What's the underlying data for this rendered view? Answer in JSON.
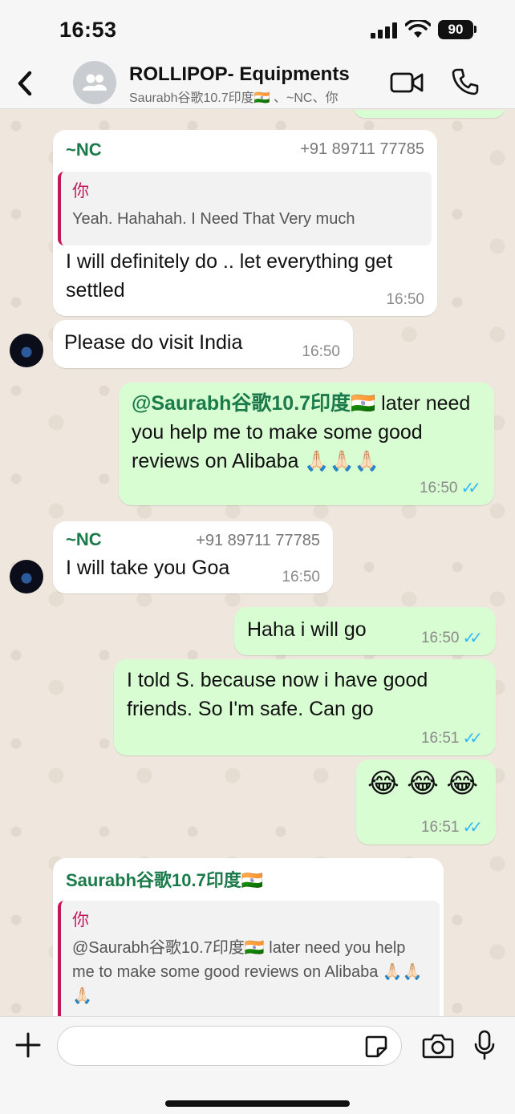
{
  "status": {
    "time": "16:53",
    "battery": "90"
  },
  "header": {
    "title": "ROLLIPOP- Equipments",
    "subtitle": "Saurabh谷歌10.7印度🇮🇳 、~NC、你"
  },
  "messages": {
    "m1": {
      "sender": "~NC",
      "phone": "+91 89711 77785",
      "quote_author": "你",
      "quote_text": "Yeah. Hahahah. I Need That Very much",
      "text": "I will definitely do .. let everything get settled",
      "time": "16:50"
    },
    "m2": {
      "text": "Please do visit India",
      "time": "16:50"
    },
    "m3": {
      "mention": "@Saurabh谷歌10.7印度🇮🇳",
      "text": " later need you help me to make some good reviews on Alibaba 🙏🏻🙏🏻🙏🏻",
      "time": "16:50"
    },
    "m4": {
      "sender": "~NC",
      "phone": "+91 89711 77785",
      "text": "I will take you Goa",
      "time": "16:50"
    },
    "m5": {
      "text": "Haha  i will go",
      "time": "16:50"
    },
    "m6": {
      "text": "I told S. because now i have good friends. So I'm safe. Can go",
      "time": "16:51"
    },
    "m7": {
      "text": "😂 😂 😂",
      "time": "16:51"
    },
    "m8": {
      "sender": "Saurabh谷歌10.7印度🇮🇳",
      "quote_author": "你",
      "quote_mention": "@Saurabh谷歌10.7印度🇮🇳",
      "quote_text": " later need you help me to make some good reviews on Alibaba 🙏🏻🙏🏻🙏🏻"
    }
  },
  "composer": {
    "placeholder": ""
  },
  "colors": {
    "outgoing_bubble": "#d9fdd3",
    "incoming_bubble": "#ffffff",
    "sender_green": "#1b7a4a",
    "quote_bar": "#c2185b",
    "read_ticks": "#34b7f1"
  }
}
